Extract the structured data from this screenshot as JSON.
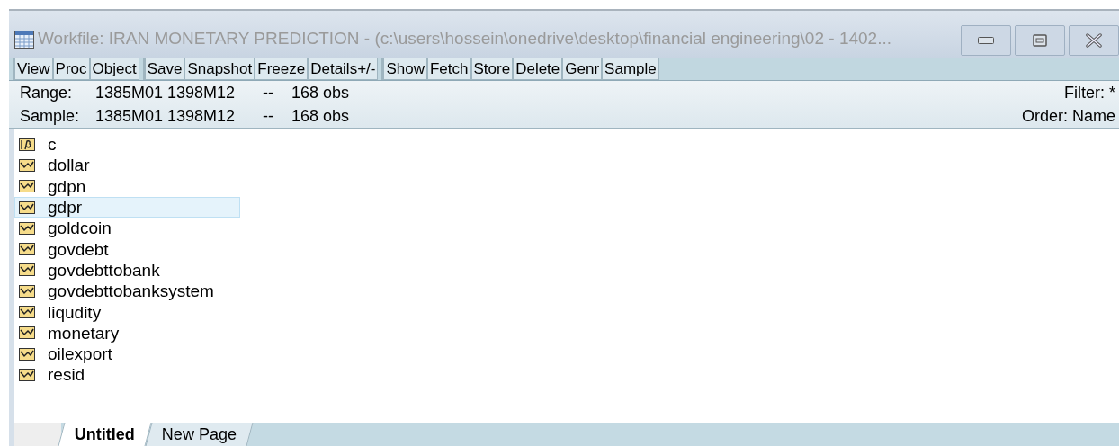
{
  "window": {
    "title": "Workfile: IRAN MONETARY PREDICTION - (c:\\users\\hossein\\onedrive\\desktop\\financial engineering\\02 - 1402..."
  },
  "toolbar": [
    {
      "buttons": [
        "View",
        "Proc",
        "Object"
      ]
    },
    {
      "buttons": [
        "Save",
        "Snapshot",
        "Freeze",
        "Details+/-"
      ]
    },
    {
      "buttons": [
        "Show",
        "Fetch",
        "Store",
        "Delete",
        "Genr",
        "Sample"
      ]
    }
  ],
  "info": {
    "range_label": "Range:",
    "range": "1385M01 1398M12",
    "range_sep": "--",
    "range_obs": "168 obs",
    "filter": "Filter: *",
    "sample_label": "Sample:",
    "sample": "1385M01 1398M12",
    "sample_sep": "--",
    "sample_obs": "168 obs",
    "order": "Order: Name"
  },
  "objects": [
    {
      "kind": "coef",
      "name": "c",
      "selected": false
    },
    {
      "kind": "series",
      "name": "dollar",
      "selected": false
    },
    {
      "kind": "series",
      "name": "gdpn",
      "selected": false
    },
    {
      "kind": "series",
      "name": "gdpr",
      "selected": true
    },
    {
      "kind": "series",
      "name": "goldcoin",
      "selected": false
    },
    {
      "kind": "series",
      "name": "govdebt",
      "selected": false
    },
    {
      "kind": "series",
      "name": "govdebttobank",
      "selected": false
    },
    {
      "kind": "series",
      "name": "govdebttobanksystem",
      "selected": false
    },
    {
      "kind": "series",
      "name": "liqudity",
      "selected": false
    },
    {
      "kind": "series",
      "name": "monetary",
      "selected": false
    },
    {
      "kind": "series",
      "name": "oilexport",
      "selected": false
    },
    {
      "kind": "series",
      "name": "resid",
      "selected": false
    }
  ],
  "page_tabs": [
    {
      "label": "Untitled",
      "selected": true
    },
    {
      "label": "New Page",
      "selected": false
    }
  ]
}
